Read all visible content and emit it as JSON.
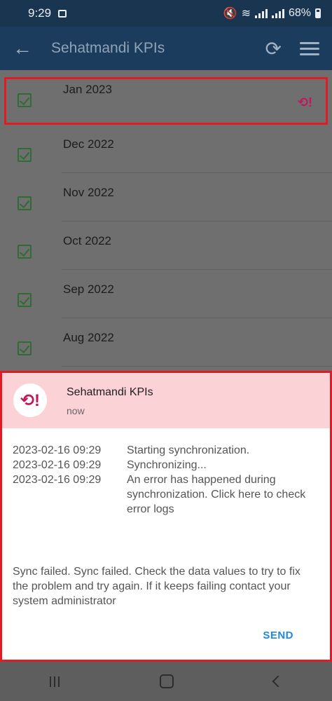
{
  "status_bar": {
    "time": "9:29",
    "battery": "68%"
  },
  "app_bar": {
    "title": "Sehatmandi KPIs"
  },
  "list": {
    "items": [
      {
        "label": "Jan 2023"
      },
      {
        "label": "Dec 2022"
      },
      {
        "label": "Nov 2022"
      },
      {
        "label": "Oct 2022"
      },
      {
        "label": "Sep 2022"
      },
      {
        "label": "Aug 2022"
      }
    ]
  },
  "notification": {
    "app_name": "Sehatmandi KPIs",
    "time": "now",
    "logs": [
      {
        "timestamp": "2023-02-16 09:29",
        "message": "Starting synchronization."
      },
      {
        "timestamp": "2023-02-16 09:29",
        "message": "Synchronizing..."
      },
      {
        "timestamp": "2023-02-16 09:29",
        "message": "An error has happened during synchronization. Click here to check error logs"
      }
    ],
    "body": "Sync failed. Sync failed. Check the data values to try to fix the problem and try again. If it keeps failing contact your system administrator",
    "send_label": "SEND"
  },
  "colors": {
    "error": "#c2185b",
    "accent": "#1e88e5",
    "highlight_border": "#e01b24"
  }
}
